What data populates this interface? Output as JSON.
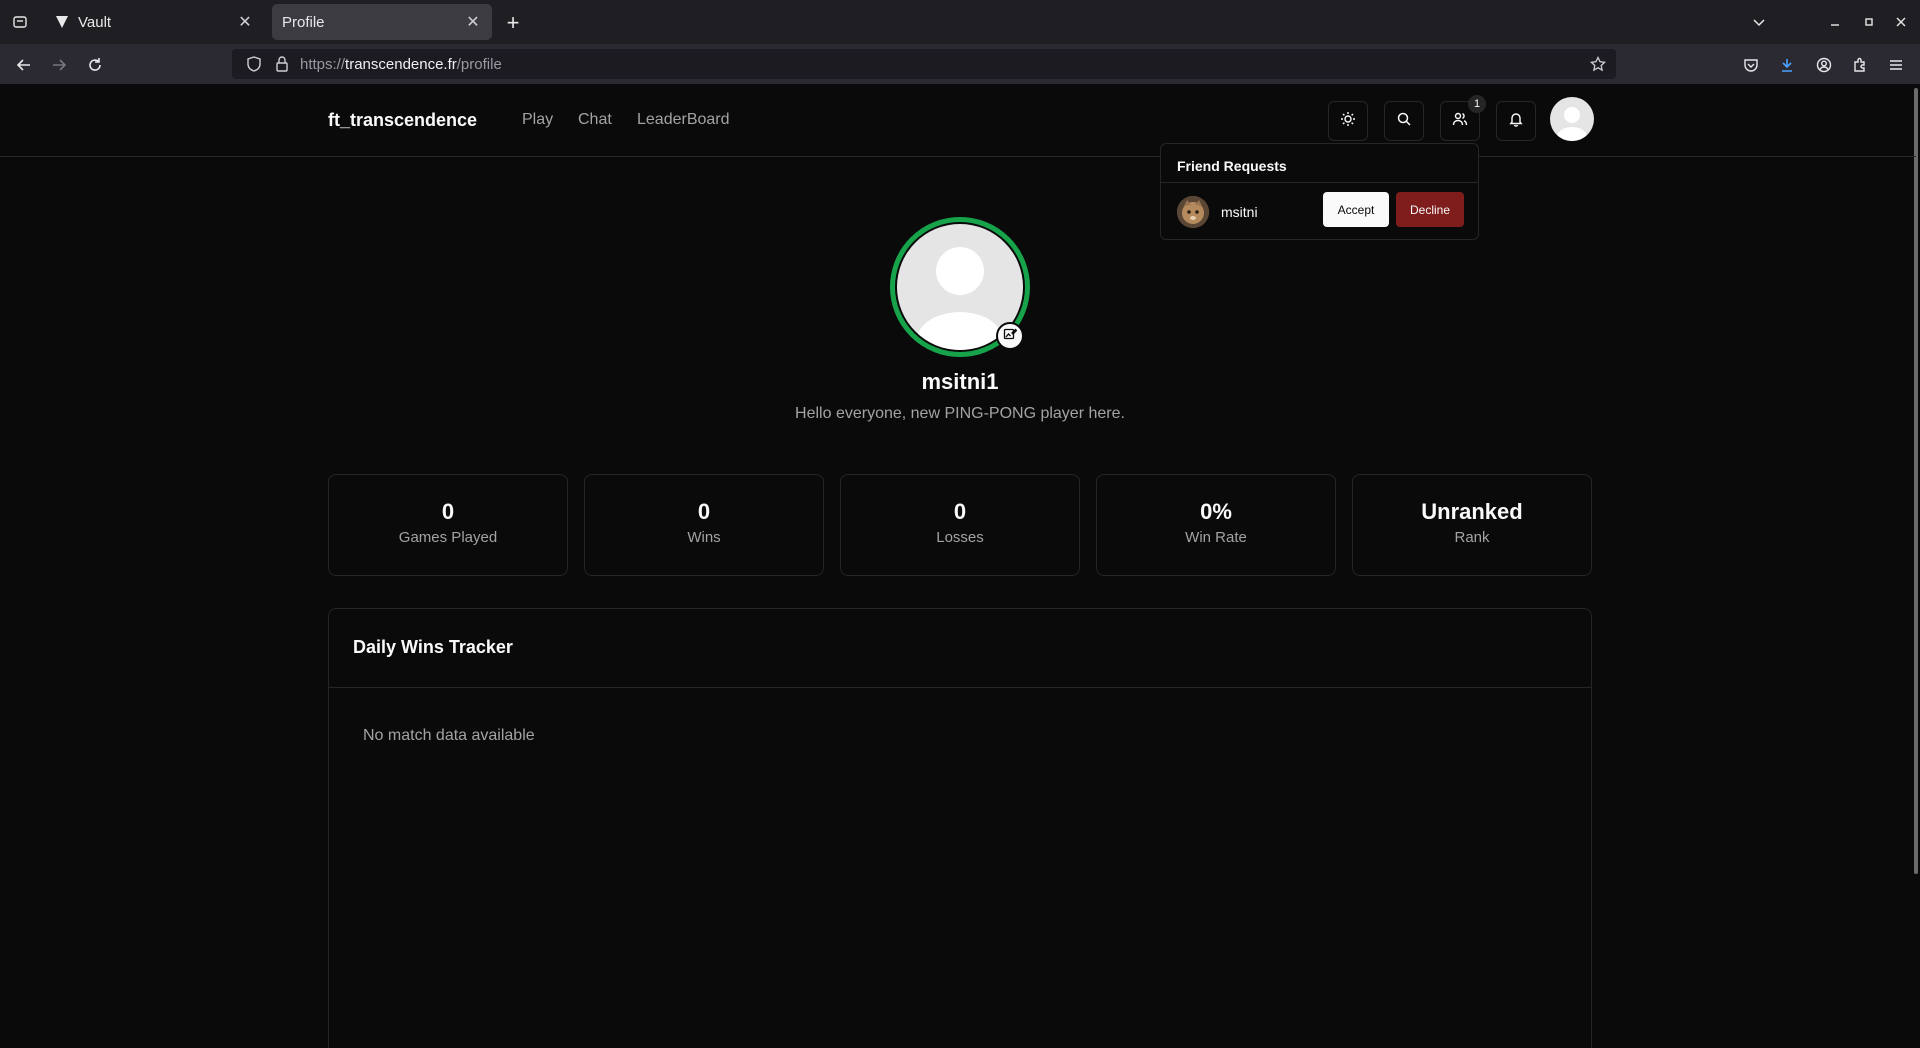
{
  "browser": {
    "tabs": [
      {
        "title": "Vault"
      },
      {
        "title": "Profile"
      }
    ],
    "url": {
      "scheme": "https://",
      "host": "transcendence.fr",
      "path": "/profile"
    }
  },
  "header": {
    "brand": "ft_transcendence",
    "nav": [
      "Play",
      "Chat",
      "LeaderBoard"
    ],
    "friend_badge": "1"
  },
  "friend_requests": {
    "title": "Friend Requests",
    "items": [
      {
        "name": "msitni",
        "accept_label": "Accept",
        "decline_label": "Decline"
      }
    ]
  },
  "profile": {
    "username": "msitni1",
    "bio": "Hello everyone, new PING-PONG player here.",
    "ring_color": "#16a34a"
  },
  "stats": [
    {
      "value": "0",
      "label": "Games Played"
    },
    {
      "value": "0",
      "label": "Wins"
    },
    {
      "value": "0",
      "label": "Losses"
    },
    {
      "value": "0%",
      "label": "Win Rate"
    },
    {
      "value": "Unranked",
      "label": "Rank"
    }
  ],
  "tracker": {
    "title": "Daily Wins Tracker",
    "empty_message": "No match data available"
  },
  "colors": {
    "background": "#0a0a0a",
    "border": "#262626",
    "decline": "#7f1d1d",
    "accent_ring": "#16a34a"
  }
}
